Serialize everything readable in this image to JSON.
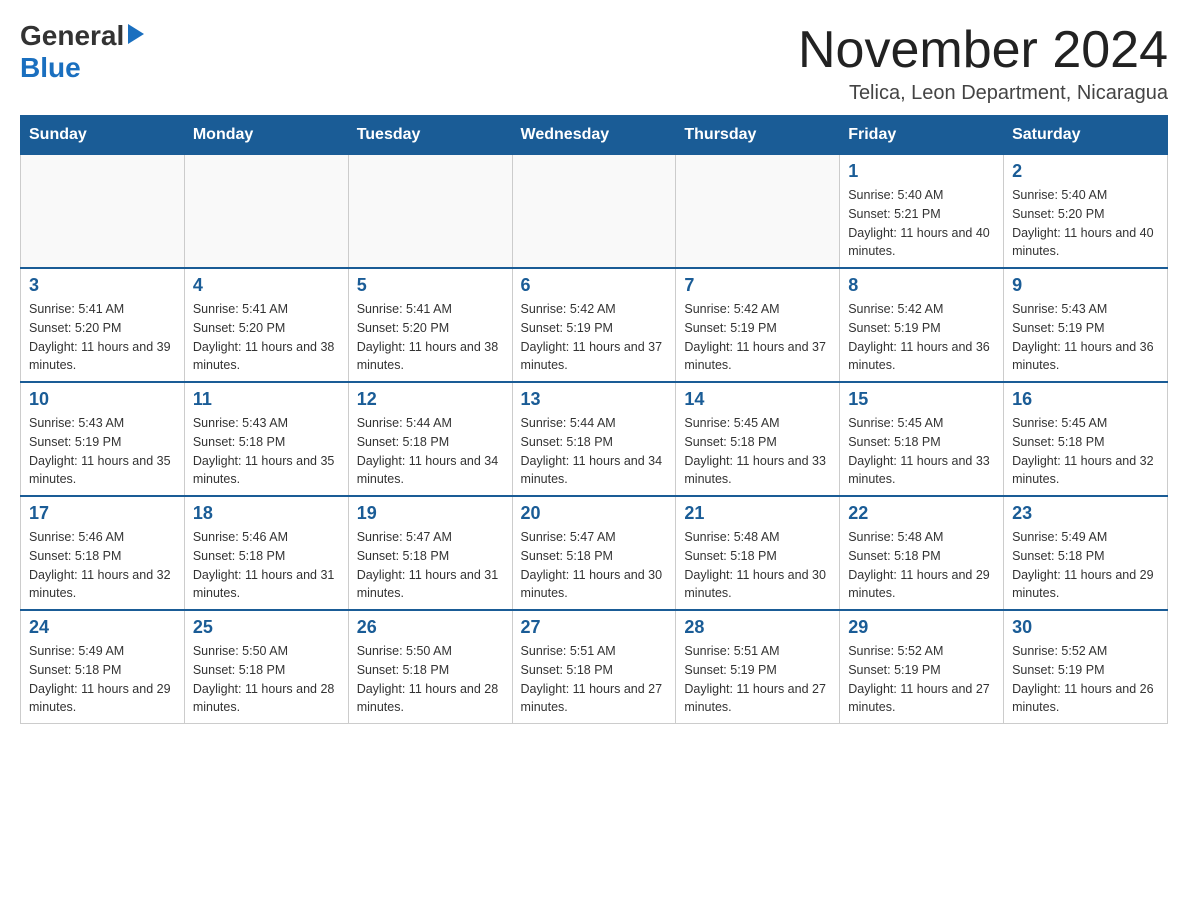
{
  "header": {
    "logo_general": "General",
    "logo_blue": "Blue",
    "month_title": "November 2024",
    "location": "Telica, Leon Department, Nicaragua"
  },
  "days_of_week": [
    "Sunday",
    "Monday",
    "Tuesday",
    "Wednesday",
    "Thursday",
    "Friday",
    "Saturday"
  ],
  "weeks": [
    [
      {
        "day": "",
        "info": ""
      },
      {
        "day": "",
        "info": ""
      },
      {
        "day": "",
        "info": ""
      },
      {
        "day": "",
        "info": ""
      },
      {
        "day": "",
        "info": ""
      },
      {
        "day": "1",
        "info": "Sunrise: 5:40 AM\nSunset: 5:21 PM\nDaylight: 11 hours and 40 minutes."
      },
      {
        "day": "2",
        "info": "Sunrise: 5:40 AM\nSunset: 5:20 PM\nDaylight: 11 hours and 40 minutes."
      }
    ],
    [
      {
        "day": "3",
        "info": "Sunrise: 5:41 AM\nSunset: 5:20 PM\nDaylight: 11 hours and 39 minutes."
      },
      {
        "day": "4",
        "info": "Sunrise: 5:41 AM\nSunset: 5:20 PM\nDaylight: 11 hours and 38 minutes."
      },
      {
        "day": "5",
        "info": "Sunrise: 5:41 AM\nSunset: 5:20 PM\nDaylight: 11 hours and 38 minutes."
      },
      {
        "day": "6",
        "info": "Sunrise: 5:42 AM\nSunset: 5:19 PM\nDaylight: 11 hours and 37 minutes."
      },
      {
        "day": "7",
        "info": "Sunrise: 5:42 AM\nSunset: 5:19 PM\nDaylight: 11 hours and 37 minutes."
      },
      {
        "day": "8",
        "info": "Sunrise: 5:42 AM\nSunset: 5:19 PM\nDaylight: 11 hours and 36 minutes."
      },
      {
        "day": "9",
        "info": "Sunrise: 5:43 AM\nSunset: 5:19 PM\nDaylight: 11 hours and 36 minutes."
      }
    ],
    [
      {
        "day": "10",
        "info": "Sunrise: 5:43 AM\nSunset: 5:19 PM\nDaylight: 11 hours and 35 minutes."
      },
      {
        "day": "11",
        "info": "Sunrise: 5:43 AM\nSunset: 5:18 PM\nDaylight: 11 hours and 35 minutes."
      },
      {
        "day": "12",
        "info": "Sunrise: 5:44 AM\nSunset: 5:18 PM\nDaylight: 11 hours and 34 minutes."
      },
      {
        "day": "13",
        "info": "Sunrise: 5:44 AM\nSunset: 5:18 PM\nDaylight: 11 hours and 34 minutes."
      },
      {
        "day": "14",
        "info": "Sunrise: 5:45 AM\nSunset: 5:18 PM\nDaylight: 11 hours and 33 minutes."
      },
      {
        "day": "15",
        "info": "Sunrise: 5:45 AM\nSunset: 5:18 PM\nDaylight: 11 hours and 33 minutes."
      },
      {
        "day": "16",
        "info": "Sunrise: 5:45 AM\nSunset: 5:18 PM\nDaylight: 11 hours and 32 minutes."
      }
    ],
    [
      {
        "day": "17",
        "info": "Sunrise: 5:46 AM\nSunset: 5:18 PM\nDaylight: 11 hours and 32 minutes."
      },
      {
        "day": "18",
        "info": "Sunrise: 5:46 AM\nSunset: 5:18 PM\nDaylight: 11 hours and 31 minutes."
      },
      {
        "day": "19",
        "info": "Sunrise: 5:47 AM\nSunset: 5:18 PM\nDaylight: 11 hours and 31 minutes."
      },
      {
        "day": "20",
        "info": "Sunrise: 5:47 AM\nSunset: 5:18 PM\nDaylight: 11 hours and 30 minutes."
      },
      {
        "day": "21",
        "info": "Sunrise: 5:48 AM\nSunset: 5:18 PM\nDaylight: 11 hours and 30 minutes."
      },
      {
        "day": "22",
        "info": "Sunrise: 5:48 AM\nSunset: 5:18 PM\nDaylight: 11 hours and 29 minutes."
      },
      {
        "day": "23",
        "info": "Sunrise: 5:49 AM\nSunset: 5:18 PM\nDaylight: 11 hours and 29 minutes."
      }
    ],
    [
      {
        "day": "24",
        "info": "Sunrise: 5:49 AM\nSunset: 5:18 PM\nDaylight: 11 hours and 29 minutes."
      },
      {
        "day": "25",
        "info": "Sunrise: 5:50 AM\nSunset: 5:18 PM\nDaylight: 11 hours and 28 minutes."
      },
      {
        "day": "26",
        "info": "Sunrise: 5:50 AM\nSunset: 5:18 PM\nDaylight: 11 hours and 28 minutes."
      },
      {
        "day": "27",
        "info": "Sunrise: 5:51 AM\nSunset: 5:18 PM\nDaylight: 11 hours and 27 minutes."
      },
      {
        "day": "28",
        "info": "Sunrise: 5:51 AM\nSunset: 5:19 PM\nDaylight: 11 hours and 27 minutes."
      },
      {
        "day": "29",
        "info": "Sunrise: 5:52 AM\nSunset: 5:19 PM\nDaylight: 11 hours and 27 minutes."
      },
      {
        "day": "30",
        "info": "Sunrise: 5:52 AM\nSunset: 5:19 PM\nDaylight: 11 hours and 26 minutes."
      }
    ]
  ]
}
